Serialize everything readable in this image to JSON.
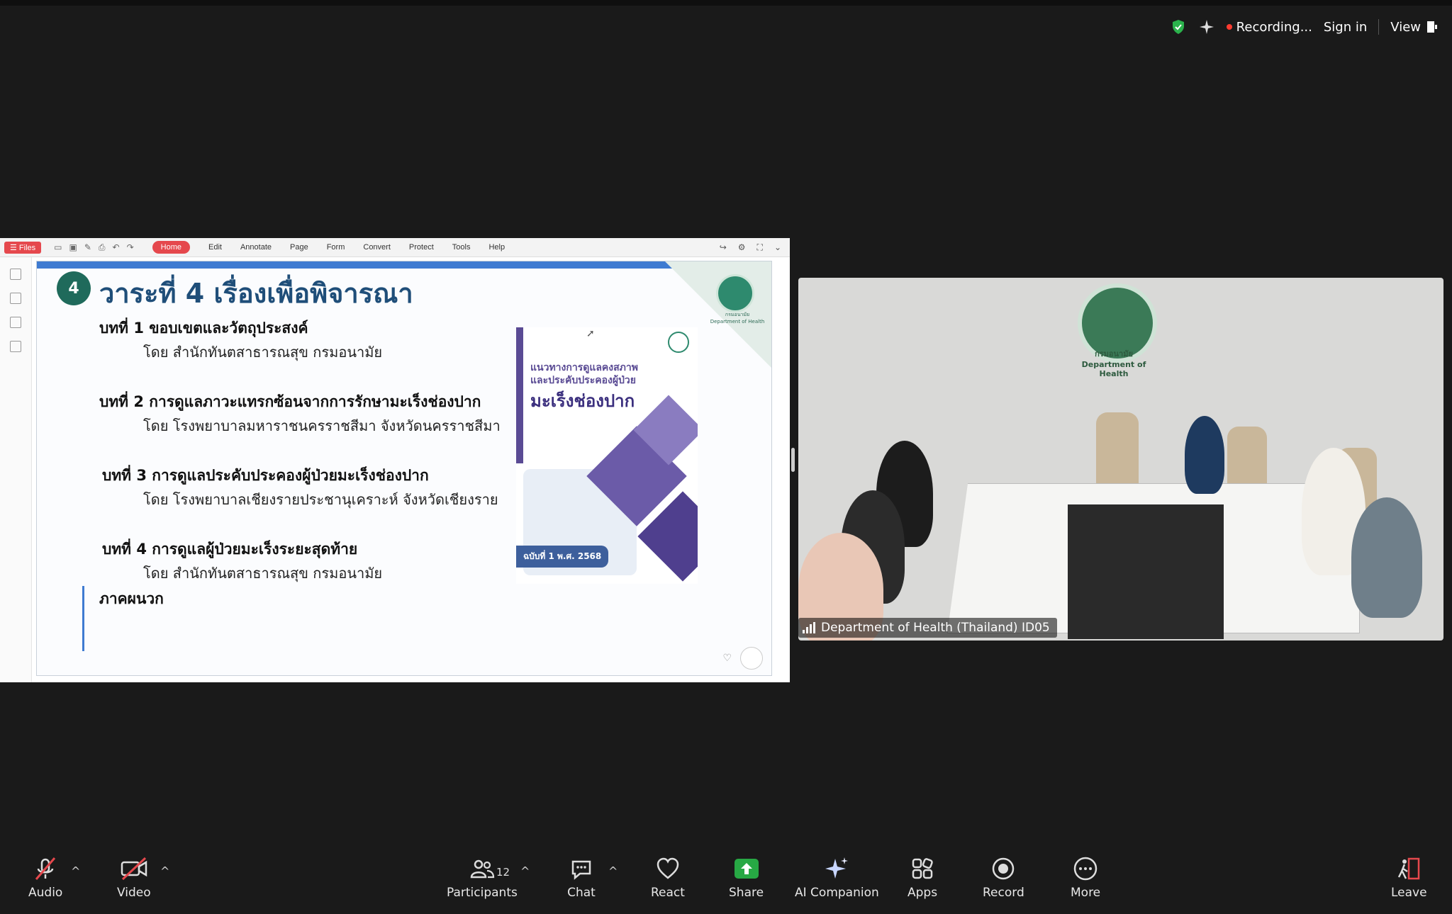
{
  "top_bar": {
    "recording": "Recording...",
    "sign_in": "Sign in",
    "view": "View"
  },
  "pdf_toolbar": {
    "files": "Files",
    "menu": [
      "Home",
      "Edit",
      "Annotate",
      "Page",
      "Form",
      "Convert",
      "Protect",
      "Tools",
      "Help"
    ]
  },
  "slide": {
    "number": "4",
    "title": "วาระที่ 4  เรื่องเพื่อพิจารณา",
    "items": [
      {
        "title": "บทที่ 1 ขอบเขตและวัตถุประสงค์",
        "sub": "โดย สำนักทันตสาธารณสุข กรมอนามัย"
      },
      {
        "title": "บทที่ 2  การดูแลภาวะแทรกซ้อนจากการรักษามะเร็งช่องปาก",
        "sub": "โดย โรงพยาบาลมหาราชนครราชสีมา จังหวัดนครราชสีมา"
      },
      {
        "title": "บทที่ 3 การดูแลประคับประคองผู้ป่วยมะเร็งช่องปาก",
        "sub": "โดย โรงพยาบาลเชียงรายประชานุเคราะห์ จังหวัดเชียงราย"
      },
      {
        "title": "บทที่ 4  การดูแลผู้ป่วยมะเร็งระยะสุดท้าย",
        "sub": "โดย สำนักทันตสาธารณสุข กรมอนามัย"
      }
    ],
    "appendix": "ภาคผนวก",
    "book_title1": "แนวทางการดูแลคงสภาพ",
    "book_title2": "และประคับประคองผู้ป่วย",
    "book_title3": "มะเร็งช่องปาก",
    "book_badge": "ฉบับที่ 1 พ.ศ. 2568"
  },
  "video": {
    "wall_text_th": "กรมอนามัย",
    "wall_text_en": "Department of Health",
    "participant_name": "Department of Health (Thailand) ID05"
  },
  "controls": {
    "audio": "Audio",
    "video": "Video",
    "participants": "Participants",
    "participants_count": "12",
    "chat": "Chat",
    "react": "React",
    "share": "Share",
    "ai_companion": "AI Companion",
    "apps": "Apps",
    "record": "Record",
    "more": "More",
    "leave": "Leave"
  },
  "colors": {
    "background": "#1a1a1a",
    "share_accent": "#27a844",
    "leave_accent": "#e5484d",
    "recording_dot": "#ff3b30"
  }
}
